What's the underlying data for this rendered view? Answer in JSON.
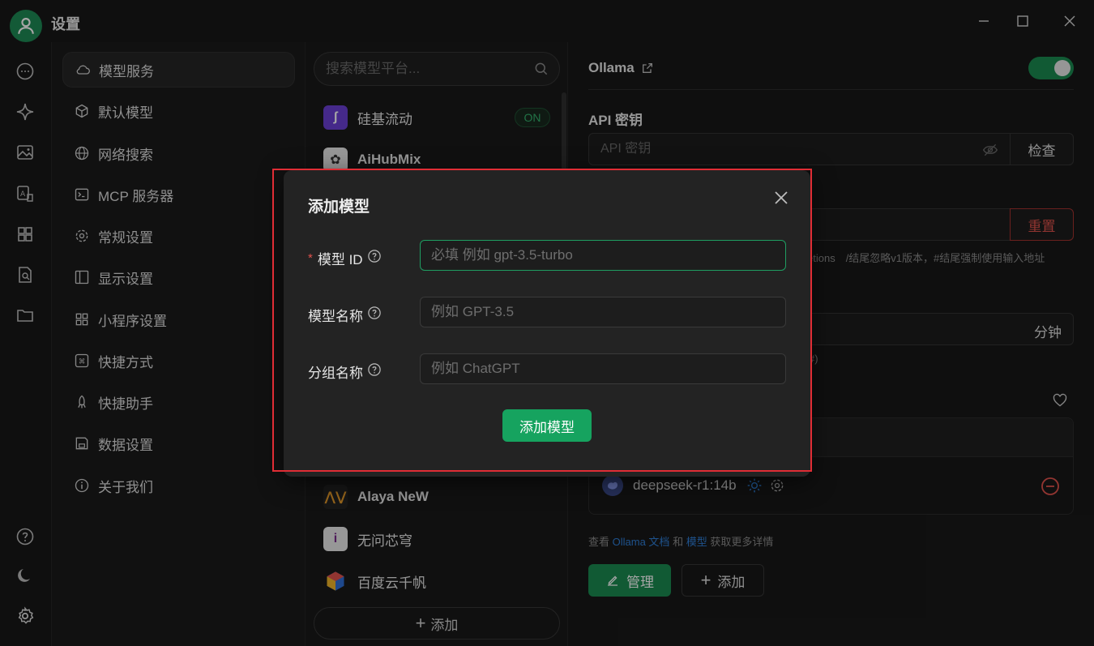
{
  "window": {
    "title": "设置"
  },
  "nav": {
    "items": [
      {
        "label": "模型服务",
        "icon": "cloud-icon",
        "active": true
      },
      {
        "label": "默认模型",
        "icon": "cube-icon"
      },
      {
        "label": "网络搜索",
        "icon": "globe-icon"
      },
      {
        "label": "MCP 服务器",
        "icon": "terminal-icon"
      },
      {
        "label": "常规设置",
        "icon": "gear-icon"
      },
      {
        "label": "显示设置",
        "icon": "layout-icon"
      },
      {
        "label": "小程序设置",
        "icon": "grid-icon"
      },
      {
        "label": "快捷方式",
        "icon": "command-icon"
      },
      {
        "label": "快捷助手",
        "icon": "rocket-icon"
      },
      {
        "label": "数据设置",
        "icon": "save-icon"
      },
      {
        "label": "关于我们",
        "icon": "info-icon"
      }
    ]
  },
  "providers": {
    "search_placeholder": "搜索模型平台...",
    "items": [
      {
        "name": "硅基流动",
        "badge": "ON"
      },
      {
        "name": "AiHubMix"
      },
      {
        "name": "Alaya NeW"
      },
      {
        "name": "无问芯穹"
      },
      {
        "name": "百度云千帆"
      }
    ],
    "add_label": "添加"
  },
  "detail": {
    "provider_title": "Ollama",
    "api_key_label": "API 密钥",
    "api_key_placeholder": "API 密钥",
    "check_label": "检查",
    "reset_label": "重置",
    "url_hint": "etions　/结尾忽略v1版本，#结尾强制使用输入地址",
    "minutes_label": "分钟",
    "hash_hint": "#)",
    "model_name": "deepseek-r1:14b",
    "footer": {
      "prefix": "查看",
      "docs_link": "Ollama 文档",
      "and": "和",
      "models_link": "模型",
      "suffix": "获取更多详情"
    },
    "manage_label": "管理",
    "add_label": "添加"
  },
  "modal": {
    "title": "添加模型",
    "fields": [
      {
        "label": "模型 ID",
        "required": true,
        "placeholder": "必填 例如 gpt-3.5-turbo"
      },
      {
        "label": "模型名称",
        "required": false,
        "placeholder": "例如 GPT-3.5"
      },
      {
        "label": "分组名称",
        "required": false,
        "placeholder": "例如 ChatGPT"
      }
    ],
    "required_mark": "*",
    "submit_label": "添加模型"
  },
  "colors": {
    "accent": "#1b8a51",
    "highlight": "#e02d35",
    "danger": "#e0524c",
    "link": "#2f7fd8"
  }
}
